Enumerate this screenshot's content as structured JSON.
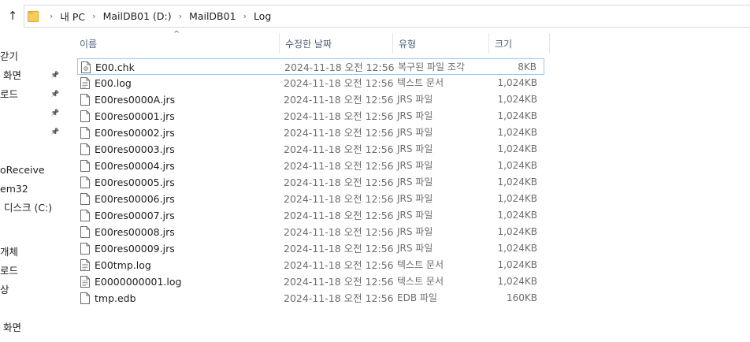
{
  "address": {
    "crumbs": [
      "내 PC",
      "MailDB01 (D:)",
      "MailDB01",
      "Log"
    ]
  },
  "nav": {
    "items": [
      {
        "label": "갇기",
        "pinned": false
      },
      {
        "label": "화면",
        "pinned": true
      },
      {
        "label": "로드",
        "pinned": true
      },
      {
        "label": "",
        "pinned": true
      },
      {
        "label": "",
        "pinned": true
      },
      {
        "label": "oReceive",
        "pinned": false
      },
      {
        "label": "em32",
        "pinned": false
      },
      {
        "label": "디스크 (C:)",
        "pinned": false
      },
      {
        "label": "개체",
        "pinned": false
      },
      {
        "label": "로드",
        "pinned": false
      },
      {
        "label": "상",
        "pinned": false
      },
      {
        "label": "화면",
        "pinned": false
      }
    ]
  },
  "list": {
    "columns": [
      "이름",
      "수정한 날짜",
      "유형",
      "크기"
    ],
    "sort_indicator": "^",
    "files": [
      {
        "name": "E00.chk",
        "date": "2024-11-18 오전 12:56",
        "type": "복구된 파일 조각",
        "size": "8KB",
        "icon": "chk-file-icon",
        "selected": true
      },
      {
        "name": "E00.log",
        "date": "2024-11-18 오전 12:56",
        "type": "텍스트 문서",
        "size": "1,024KB",
        "icon": "text-file-icon"
      },
      {
        "name": "E00res0000A.jrs",
        "date": "2024-11-18 오전 12:56",
        "type": "JRS 파일",
        "size": "1,024KB",
        "icon": "file-icon"
      },
      {
        "name": "E00res00001.jrs",
        "date": "2024-11-18 오전 12:56",
        "type": "JRS 파일",
        "size": "1,024KB",
        "icon": "file-icon"
      },
      {
        "name": "E00res00002.jrs",
        "date": "2024-11-18 오전 12:56",
        "type": "JRS 파일",
        "size": "1,024KB",
        "icon": "file-icon"
      },
      {
        "name": "E00res00003.jrs",
        "date": "2024-11-18 오전 12:56",
        "type": "JRS 파일",
        "size": "1,024KB",
        "icon": "file-icon"
      },
      {
        "name": "E00res00004.jrs",
        "date": "2024-11-18 오전 12:56",
        "type": "JRS 파일",
        "size": "1,024KB",
        "icon": "file-icon"
      },
      {
        "name": "E00res00005.jrs",
        "date": "2024-11-18 오전 12:56",
        "type": "JRS 파일",
        "size": "1,024KB",
        "icon": "file-icon"
      },
      {
        "name": "E00res00006.jrs",
        "date": "2024-11-18 오전 12:56",
        "type": "JRS 파일",
        "size": "1,024KB",
        "icon": "file-icon"
      },
      {
        "name": "E00res00007.jrs",
        "date": "2024-11-18 오전 12:56",
        "type": "JRS 파일",
        "size": "1,024KB",
        "icon": "file-icon"
      },
      {
        "name": "E00res00008.jrs",
        "date": "2024-11-18 오전 12:56",
        "type": "JRS 파일",
        "size": "1,024KB",
        "icon": "file-icon"
      },
      {
        "name": "E00res00009.jrs",
        "date": "2024-11-18 오전 12:56",
        "type": "JRS 파일",
        "size": "1,024KB",
        "icon": "file-icon"
      },
      {
        "name": "E00tmp.log",
        "date": "2024-11-18 오전 12:56",
        "type": "텍스트 문서",
        "size": "1,024KB",
        "icon": "text-file-icon"
      },
      {
        "name": "E0000000001.log",
        "date": "2024-11-18 오전 12:56",
        "type": "텍스트 문서",
        "size": "1,024KB",
        "icon": "text-file-icon"
      },
      {
        "name": "tmp.edb",
        "date": "2024-11-18 오전 12:56",
        "type": "EDB 파일",
        "size": "160KB",
        "icon": "file-icon"
      }
    ]
  },
  "colors": {
    "selection_border": "#99c9ef",
    "header_text": "#4c607a",
    "secondary_text": "#6d6d6d",
    "folder": "#f6cd5b"
  }
}
